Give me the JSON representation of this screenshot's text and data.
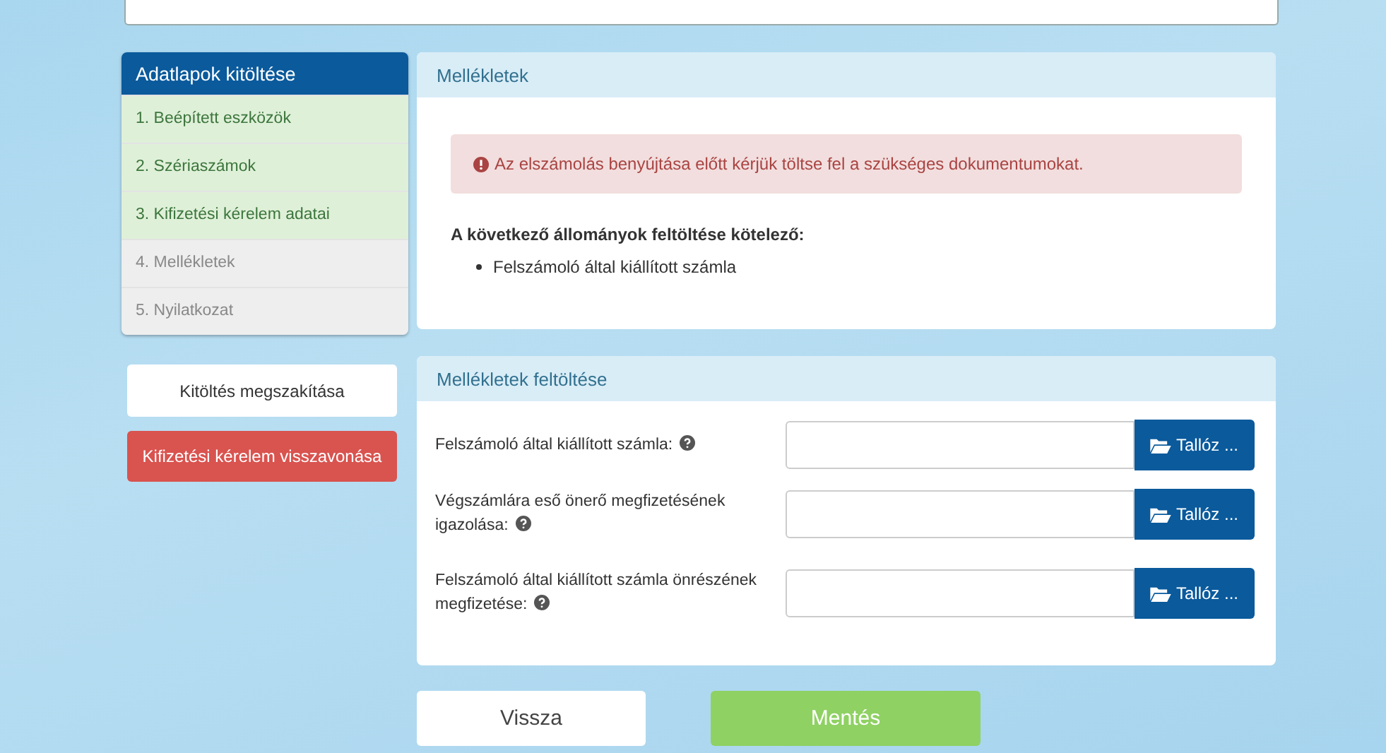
{
  "sidebar": {
    "title": "Adatlapok kitöltése",
    "steps": [
      {
        "label": "1. Beépített eszközök",
        "done": true
      },
      {
        "label": "2. Szériaszámok",
        "done": true
      },
      {
        "label": "3. Kifizetési kérelem adatai",
        "done": true
      },
      {
        "label": "4. Mellékletek",
        "done": false
      },
      {
        "label": "5. Nyilatkozat",
        "done": false
      }
    ],
    "cancel_button": "Kitöltés megszakítása",
    "withdraw_button": "Kifizetési kérelem visszavonása"
  },
  "attachments_panel": {
    "title": "Mellékletek",
    "alert": "Az elszámolás benyújtása előtt kérjük töltse fel a szükséges dokumentumokat.",
    "required_heading": "A következő állományok feltöltése kötelező:",
    "required_items": [
      "Felszámoló által kiállított számla"
    ]
  },
  "upload_panel": {
    "title": "Mellékletek feltöltése",
    "rows": [
      {
        "label": "Felszámoló által kiállított számla:",
        "button": "Tallóz ..."
      },
      {
        "label": "Végszámlára eső önerő megfizetésének igazolása:",
        "button": "Tallóz ..."
      },
      {
        "label": "Felszámoló által kiállított számla önrészének megfizetése:",
        "button": "Tallóz ..."
      }
    ]
  },
  "buttons": {
    "back": "Vissza",
    "save": "Mentés"
  }
}
